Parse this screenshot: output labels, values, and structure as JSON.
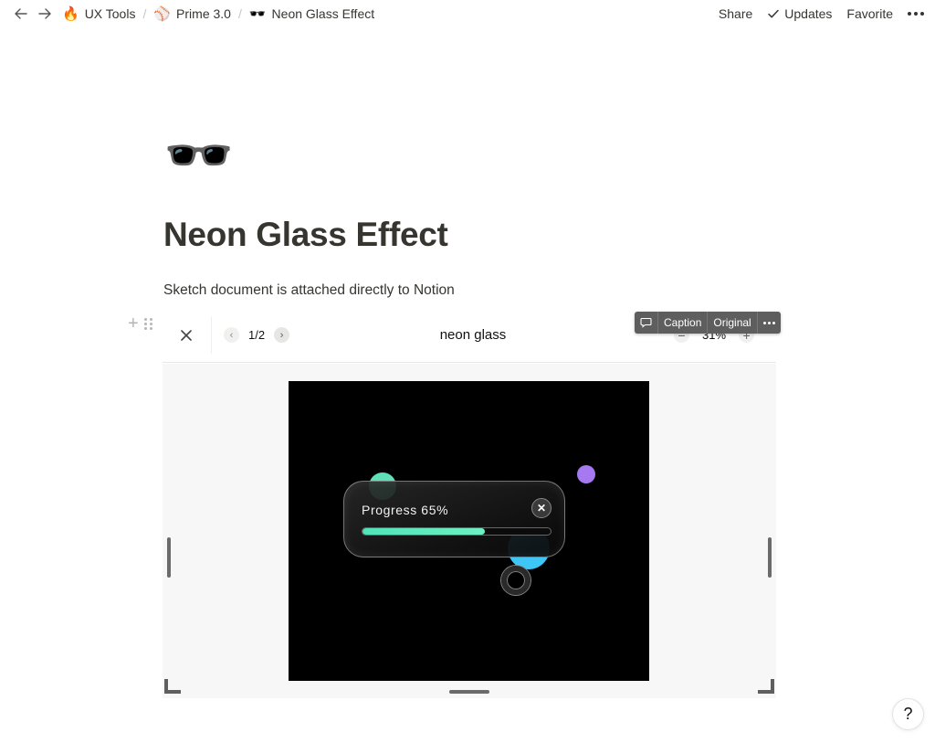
{
  "topbar": {
    "breadcrumbs": [
      {
        "emoji": "🔥",
        "label": "UX Tools"
      },
      {
        "emoji": "⚾",
        "label": "Prime 3.0"
      },
      {
        "emoji": "🕶️",
        "label": "Neon Glass Effect"
      }
    ],
    "separator": "/",
    "actions": {
      "share": "Share",
      "updates_icon": "✓",
      "updates": "Updates",
      "favorite": "Favorite"
    }
  },
  "page": {
    "icon": "🕶️",
    "title": "Neon Glass Effect",
    "description": "Sketch document is attached directly to Notion"
  },
  "embed": {
    "pager": {
      "prev": "‹",
      "current": "1/2",
      "next": "›"
    },
    "title": "neon glass",
    "zoom": {
      "minus": "−",
      "value": "31%",
      "plus": "+"
    },
    "toolbar": {
      "caption": "Caption",
      "original": "Original"
    },
    "artboard": {
      "label": "Progress 65%",
      "progress": 0.65,
      "close_glyph": "✕",
      "colors": {
        "green": "#5fe0b6",
        "purple": "#a679f2",
        "blue": "#3ec6f7"
      }
    }
  },
  "help": {
    "label": "?"
  }
}
